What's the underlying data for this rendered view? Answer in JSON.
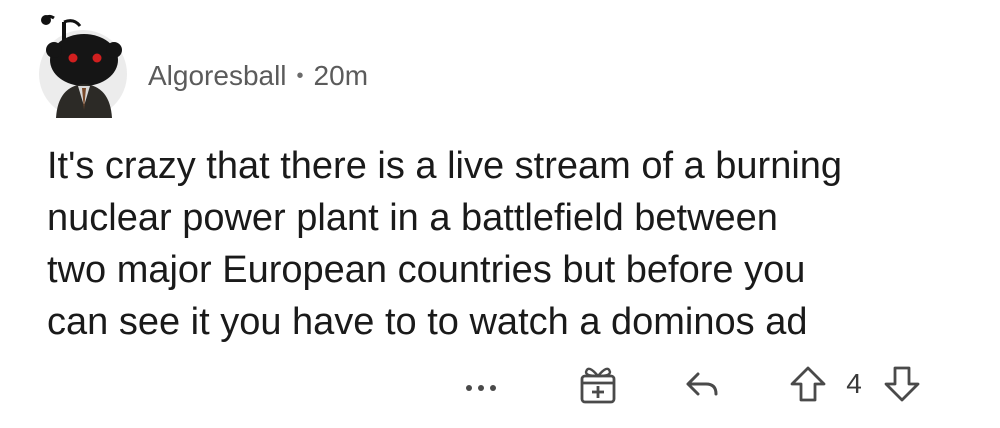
{
  "comment": {
    "author": "Algoresball",
    "separator": "•",
    "age": "20m",
    "body": "It's crazy that there is a live stream of a burning\nnuclear power plant in a battlefield between\ntwo major European countries but before you\ncan see it you have to to watch a dominos ad",
    "score": "4"
  },
  "actions": {
    "more_label": "…",
    "icons": [
      "more-icon",
      "gift-icon",
      "reply-icon",
      "upvote-icon",
      "downvote-icon"
    ]
  },
  "colors": {
    "text": "#1a1a1a",
    "meta": "#5b5b5b",
    "icon": "#4a4a4a",
    "background": "#ffffff"
  }
}
